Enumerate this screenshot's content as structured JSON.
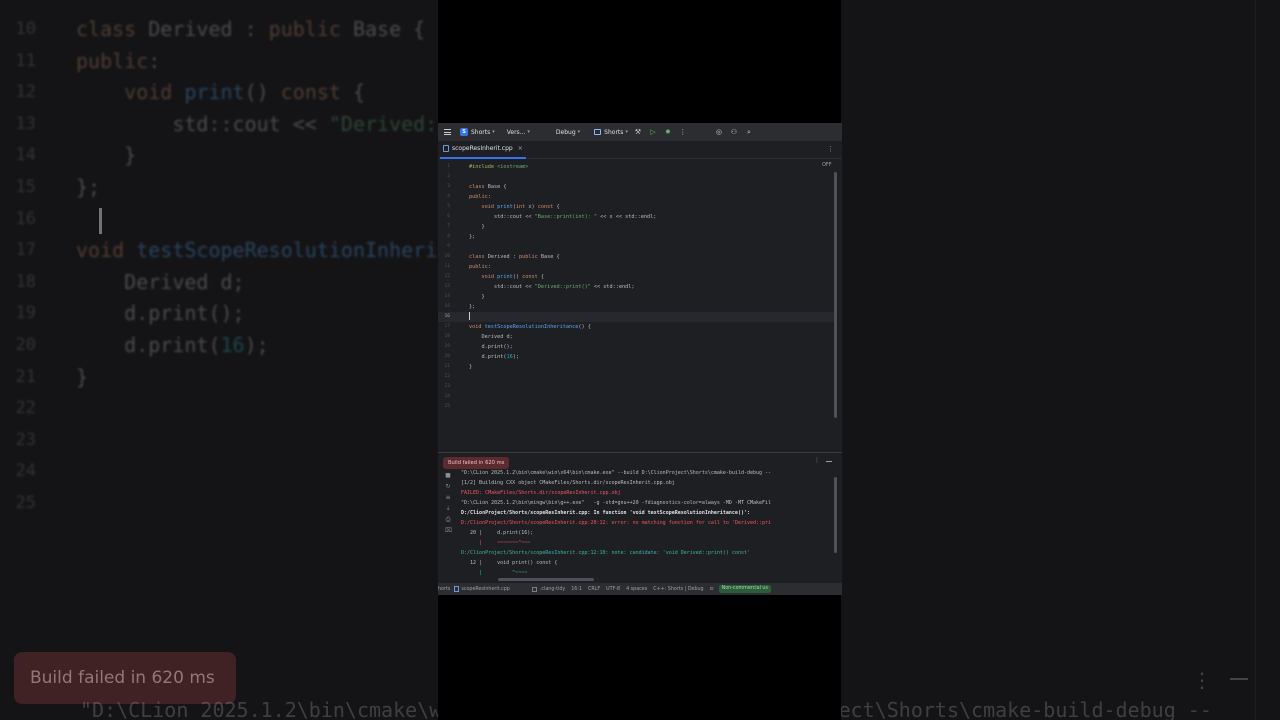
{
  "titlebar": {
    "project_badge": "S",
    "project": "Shorts",
    "vcs": "Vers...",
    "build_type": "Debug",
    "run_config": "Shorts"
  },
  "tab": {
    "filename": "scopeResInherit.cpp"
  },
  "editor": {
    "off_label": "OFF",
    "line_numbers": [
      "1",
      "2",
      "3",
      "4",
      "5",
      "6",
      "7",
      "8",
      "9",
      "10",
      "11",
      "12",
      "13",
      "14",
      "15",
      "16",
      "17",
      "18",
      "19",
      "20",
      "21",
      "22",
      "23",
      "24",
      "25"
    ],
    "current_line": "16",
    "lines": [
      "#include <iostream>",
      "",
      "class Base {",
      "public:",
      "    void print(int x) const {",
      "        std::cout << \"Base::print(int): \" << x << std::endl;",
      "    }",
      "};",
      "",
      "class Derived : public Base {",
      "public:",
      "    void print() const {",
      "        std::cout << \"Derived::print()\" << std::endl;",
      "    }",
      "};",
      "",
      "void testScopeResolutionInheritance() {",
      "    Derived d;",
      "    d.print();",
      "    d.print(16);",
      "}",
      "",
      "",
      "",
      ""
    ]
  },
  "run_panel": {
    "toast": "Build failed in 620 ms",
    "console": [
      "\"D:\\CLion 2025.1.2\\bin\\cmake\\win\\x64\\bin\\cmake.exe\" --build D:\\ClionProject\\Shorts\\cmake-build-debug --",
      "[1/2] Building CXX object CMakeFiles/Shorts.dir/scopeResInherit.cpp.obj",
      "FAILED: CMakeFiles/Shorts.dir/scopeResInherit.cpp.obj",
      "\"D:\\CLion 2025.1.2\\bin\\mingw\\bin\\g++.exe\"   -g -std=gnu++20 -fdiagnostics-color=always -MD -MT CMakeFil",
      "D:/ClionProject/Shorts/scopeResInherit.cpp: In function 'void testScopeResolutionInheritance()':",
      "D:/ClionProject/Shorts/scopeResInherit.cpp:20:12: error: no matching function for call to 'Derived::pri",
      "   20 |     d.print(16);",
      "      |     ~~~~~~~^~~~",
      "D:/ClionProject/Shorts/scopeResInherit.cpp:12:10: note: candidate: 'void Derived::print() const'",
      "   12 |     void print() const {",
      "      |          ^~~~~"
    ]
  },
  "statusbar": {
    "crumb_left": "horts",
    "crumb_file": "scopeResInherit.cpp",
    "clang_tidy": ".clang-tidy",
    "position": "16:1",
    "line_sep": "CRLF",
    "encoding": "UTF-8",
    "indent": "4 spaces",
    "context": "C++: Shorts | Debug",
    "license": "Non-commercial us"
  },
  "backdrop": {
    "toast": "Build failed in 620 ms",
    "bottom_text": "\"D:\\CLion 2025.1.2\\bin\\cmake\\win                          nProject\\Shorts\\cmake-build-debug --"
  },
  "colors": {
    "editor_bg": "#1e1f22",
    "keyword": "#cf8e6d",
    "string": "#6aab73",
    "function": "#56a8f5",
    "number": "#2aacb8",
    "error": "#f75464",
    "link": "#548af7",
    "accent": "#3574f0"
  }
}
